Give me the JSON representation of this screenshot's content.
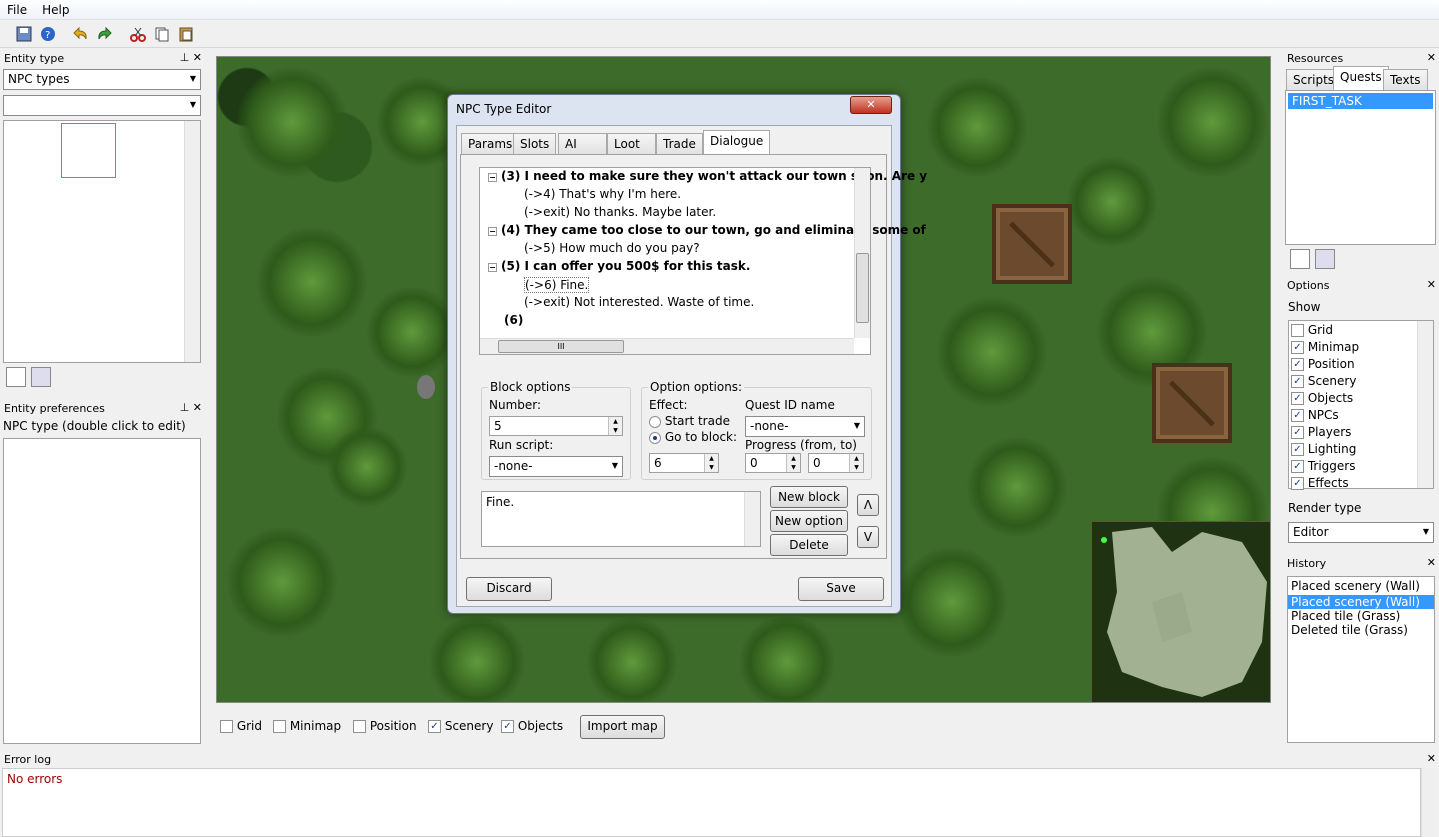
{
  "menu": {
    "file": "File",
    "help": "Help"
  },
  "entity_type": {
    "title": "Entity type",
    "combo1": "NPC types",
    "combo2": ""
  },
  "entity_prefs": {
    "title": "Entity preferences",
    "subtitle": "NPC type (double click to edit)"
  },
  "resources": {
    "title": "Resources",
    "tabs": [
      "Scripts",
      "Quests",
      "Texts"
    ],
    "items": [
      "FIRST_TASK"
    ]
  },
  "options": {
    "title": "Options",
    "show": "Show",
    "items": [
      {
        "label": "Grid",
        "checked": false
      },
      {
        "label": "Minimap",
        "checked": true
      },
      {
        "label": "Position",
        "checked": true
      },
      {
        "label": "Scenery",
        "checked": true
      },
      {
        "label": "Objects",
        "checked": true
      },
      {
        "label": "NPCs",
        "checked": true
      },
      {
        "label": "Players",
        "checked": true
      },
      {
        "label": "Lighting",
        "checked": true
      },
      {
        "label": "Triggers",
        "checked": true
      },
      {
        "label": "Effects",
        "checked": true
      }
    ],
    "render_type": "Render type",
    "render_value": "Editor"
  },
  "history": {
    "title": "History",
    "items": [
      "Placed scenery (Wall)",
      "Placed scenery (Wall)",
      "Placed tile (Grass)",
      "Deleted tile (Grass)"
    ],
    "selected": 1
  },
  "bottom_bar": {
    "grid": "Grid",
    "minimap": "Minimap",
    "position": "Position",
    "scenery": "Scenery",
    "objects": "Objects",
    "import": "Import map"
  },
  "error_log": {
    "title": "Error log",
    "text": "No errors"
  },
  "dialog": {
    "title": "NPC Type Editor",
    "tabs": [
      "Params",
      "Slots",
      "AI",
      "Loot",
      "Trade",
      "Dialogue"
    ],
    "tree": [
      "(3) I need to make sure they won't attack our town soon. Are y",
      "(->4) That's why I'm here.",
      "(->exit) No thanks. Maybe later.",
      "(4) They came too close to our town, go and eliminate some of",
      "(->5) How much do you pay?",
      "(5) I can offer you 500$ for this task.",
      "(->6) Fine.",
      "(->exit) Not interested. Waste of time.",
      "(6)"
    ],
    "block_options": "Block options",
    "number_label": "Number:",
    "number": "5",
    "run_script": "Run script:",
    "run_script_value": "-none-",
    "option_options": "Option options:",
    "effect": "Effect:",
    "start_trade": "Start trade",
    "go_to_block": "Go to block:",
    "go_to_value": "6",
    "quest_id": "Quest ID name",
    "quest_value": "-none-",
    "progress": "Progress (from, to)",
    "progress_from": "0",
    "progress_to": "0",
    "text": "Fine.",
    "new_block": "New block",
    "new_option": "New option",
    "delete": "Delete",
    "up": "Λ",
    "down": "V",
    "discard": "Discard",
    "save": "Save",
    "scroll_grip": "III"
  }
}
